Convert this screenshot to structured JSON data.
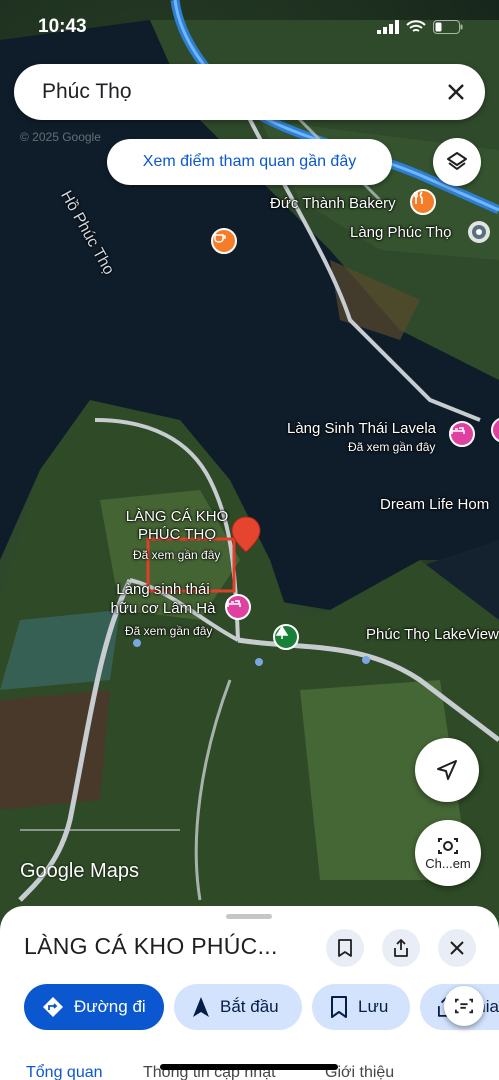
{
  "status_bar": {
    "time": "10:43"
  },
  "search": {
    "query": "Phúc Thọ"
  },
  "nearby_chip": {
    "label": "Xem điểm tham quan gần đây"
  },
  "map": {
    "water_label": "Hồ Phúc Thọ",
    "places": [
      {
        "name": "Đức Thành Bakery"
      },
      {
        "name": "Làng Phúc Thọ"
      },
      {
        "name": "Làng Sinh Thái Lavela",
        "note": "Đã xem gần đây"
      },
      {
        "name": "Dream Life Hom"
      },
      {
        "name": "LÀNG CÁ KHO PHÚC THỌ",
        "note": "Đã xem gần đây"
      },
      {
        "name": "Làng sinh thái hữu cơ Lâm Hà",
        "note": "Đã xem gần đây"
      },
      {
        "name": "Phúc Thọ LakeView"
      }
    ],
    "copyright": "© 2025 Google",
    "brand": "Google Maps"
  },
  "fab": {
    "lens_label": "Ch...em"
  },
  "sheet": {
    "title": "LÀNG CÁ KHO PHÚC...",
    "actions": [
      {
        "label": "Đường đi"
      },
      {
        "label": "Bắt đầu"
      },
      {
        "label": "Lưu"
      },
      {
        "label": "Chia"
      }
    ],
    "tabs": [
      {
        "label": "Tổng quan"
      },
      {
        "label": "Thông tin cập nhật"
      },
      {
        "label": "Giới thiệu"
      }
    ]
  },
  "colors": {
    "accent": "#0b57d0",
    "pin_red": "#ea4335",
    "hotel_pink": "#e040a0",
    "food_orange": "#f57c28"
  }
}
